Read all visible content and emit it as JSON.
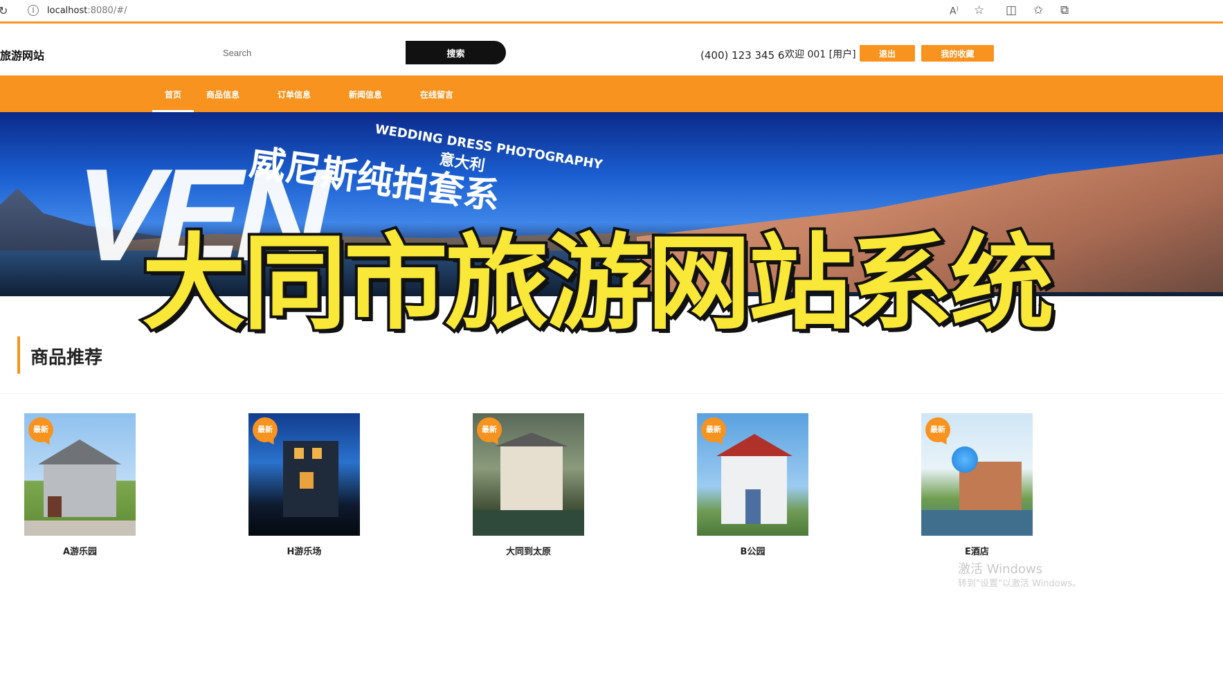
{
  "browser": {
    "url_host": "localhost",
    "url_rest": ":8080/#/"
  },
  "header": {
    "logo": "旅游网站",
    "search_placeholder": "Search",
    "search_button": "搜索",
    "phone": "(400) 123 345 6",
    "welcome": "欢迎 001 [用户]",
    "logout_button": "退出",
    "favorites_button": "我的收藏"
  },
  "nav": {
    "items": [
      "首页",
      "商品信息",
      "订单信息",
      "新闻信息",
      "在线留言"
    ],
    "active_index": 0
  },
  "banner": {
    "big_letters": "VEN",
    "cn_text": "威尼斯纯拍套系",
    "en_text": "WEDDING DRESS PHOTOGRAPHY",
    "it_text": "意大利"
  },
  "overlay_title": "大同市旅游网站系统",
  "section": {
    "title": "商品推荐"
  },
  "products": [
    {
      "name": "A游乐园",
      "badge": "最新"
    },
    {
      "name": "H游乐场",
      "badge": "最新"
    },
    {
      "name": "大同到太原",
      "badge": "最新"
    },
    {
      "name": "B公园",
      "badge": "最新"
    },
    {
      "name": "E酒店",
      "badge": "最新"
    }
  ],
  "watermark": {
    "line1": "激活 Windows",
    "line2": "转到\"设置\"以激活 Windows。"
  },
  "colors": {
    "accent": "#f7931e",
    "dark_button": "#111111",
    "overlay_text": "#f9e838"
  }
}
